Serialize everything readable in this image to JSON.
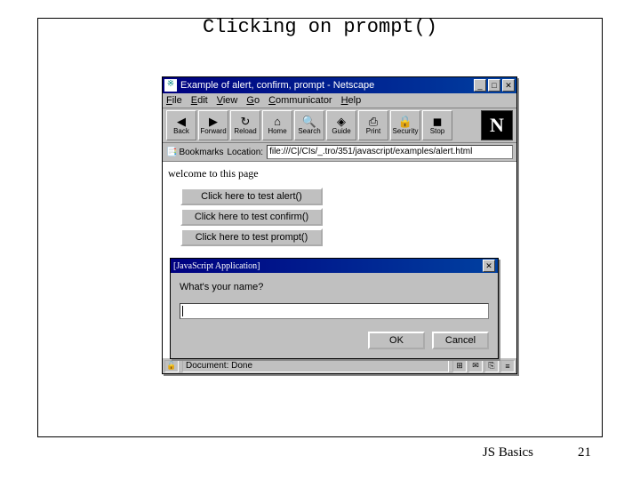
{
  "slide": {
    "title": "Clicking on prompt()",
    "footer_label": "JS Basics",
    "page_number": "21"
  },
  "window": {
    "title": "Example of alert, confirm, prompt - Netscape",
    "menus": [
      "File",
      "Edit",
      "View",
      "Go",
      "Communicator",
      "Help"
    ],
    "toolbar": [
      {
        "label": "Back",
        "glyph": "◀"
      },
      {
        "label": "Forward",
        "glyph": "▶"
      },
      {
        "label": "Reload",
        "glyph": "↻"
      },
      {
        "label": "Home",
        "glyph": "⌂"
      },
      {
        "label": "Search",
        "glyph": "🔍"
      },
      {
        "label": "Guide",
        "glyph": "◈"
      },
      {
        "label": "Print",
        "glyph": "⎙"
      },
      {
        "label": "Security",
        "glyph": "🔒"
      },
      {
        "label": "Stop",
        "glyph": "◼"
      }
    ],
    "bookmarks_label": "Bookmarks",
    "location_label": "Location:",
    "url": "file:///C|/CIs/_.tro/351/javascript/examples/alert.html",
    "page_text": "welcome to this page",
    "buttons": [
      "Click here to test alert()",
      "Click here to test confirm()",
      "Click here to test prompt()"
    ],
    "status": "Document: Done"
  },
  "dialog": {
    "title": "[JavaScript Application]",
    "prompt": "What's your name?",
    "input_value": "",
    "ok": "OK",
    "cancel": "Cancel"
  }
}
